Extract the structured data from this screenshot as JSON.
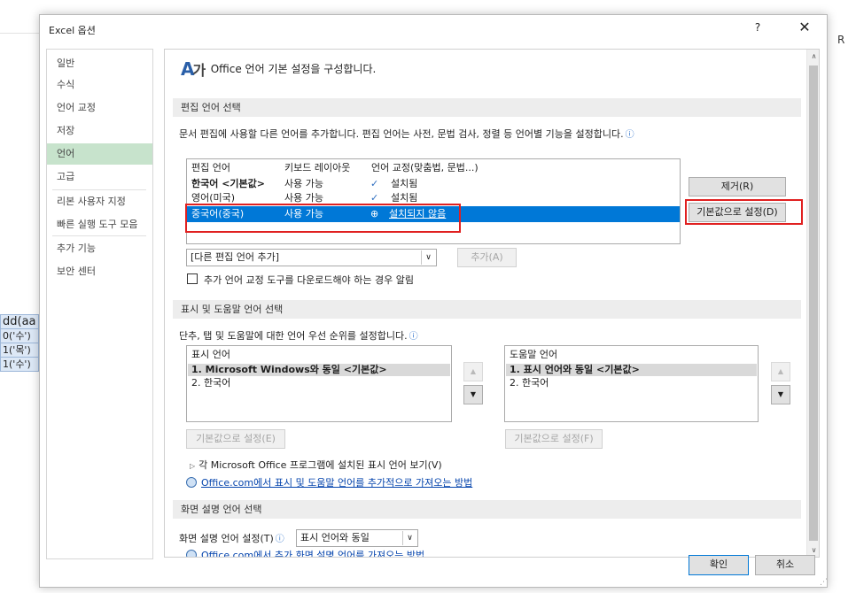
{
  "background": {
    "right_letter": "R",
    "cells": [
      "dd(aa",
      "0('수')",
      "1('목')",
      "1('수')"
    ]
  },
  "dialog": {
    "title": "Excel 옵션",
    "help": "?",
    "close": "✕"
  },
  "sidebar": {
    "items": [
      "일반",
      "수식",
      "언어 교정",
      "저장",
      "언어",
      "고급",
      "리본 사용자 지정",
      "빠른 실행 도구 모음",
      "추가 기능",
      "보안 센터"
    ],
    "active": "언어"
  },
  "content": {
    "header": "Office 언어 기본 설정을 구성합니다.",
    "edit_section": {
      "title": "편집 언어 선택",
      "description": "문서 편집에 사용할 다른 언어를 추가합니다. 편집 언어는 사전, 문법 검사, 정렬 등 언어별 기능을 설정합니다.",
      "columns": [
        "편집 언어",
        "키보드 레이아웃",
        "언어 교정(맞춤법, 문법...)"
      ],
      "rows": [
        {
          "lang": "한국어 <기본값>",
          "keyboard": "사용 가능",
          "proofing": "설치됨"
        },
        {
          "lang": "영어(미국)",
          "keyboard": "사용 가능",
          "proofing": "설치됨"
        },
        {
          "lang": "중국어(중국)",
          "keyboard": "사용 가능",
          "proofing": "설치되지 않음"
        }
      ],
      "remove_button": "제거(R)",
      "set_default_button": "기본값으로 설정(D)",
      "add_dropdown": "[다른 편집 언어 추가]",
      "add_button": "추가(A)",
      "notify_checkbox": "추가 언어 교정 도구를 다운로드해야 하는 경우 알림"
    },
    "display_section": {
      "title": "표시 및 도움말 언어 선택",
      "description": "단추, 탭 및 도움말에 대한 언어 우선 순위를 설정합니다.",
      "display_list_title": "표시 언어",
      "display_items": [
        "1.   Microsoft Windows와 동일 <기본값>",
        "2.   한국어"
      ],
      "help_list_title": "도움말 언어",
      "help_items": [
        "1.   표시 언어와 동일 <기본값>",
        "2.   한국어"
      ],
      "display_default_button": "기본값으로 설정(E)",
      "help_default_button": "기본값으로 설정(F)",
      "view_installed": "각 Microsoft Office 프로그램에 설치된 표시 언어 보기(V)",
      "more_link": "Office.com에서 표시 및 도움말 언어를 추가적으로 가져오는 방법"
    },
    "screentip_section": {
      "title": "화면 설명 언어 선택",
      "label": "화면 설명 언어 설정(T)",
      "value": "표시 언어와 동일",
      "link": "Office.com에서 추가 화면 설명 언어를 가져오는 방법"
    }
  },
  "footer": {
    "ok": "확인",
    "cancel": "취소"
  },
  "colors": {
    "selection": "#0078d7",
    "highlight_box": "#e02020",
    "active_nav": "#c7e3cc"
  }
}
